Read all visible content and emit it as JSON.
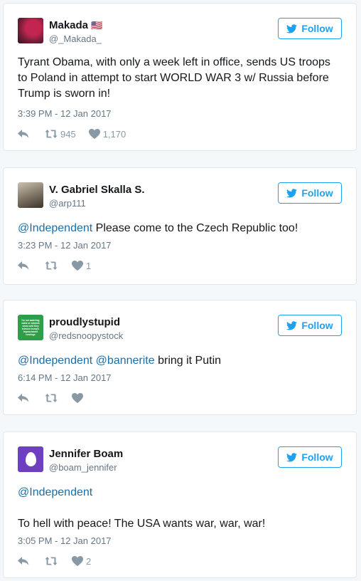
{
  "tweets": [
    {
      "name": "Makada",
      "flag": "🇺🇸",
      "handle": "@_Makada_",
      "follow_label": "Follow",
      "text_plain": "Tyrant Obama, with only a week left in office, sends US troops to Poland in attempt to start WORLD WAR 3 w/ Russia before Trump is sworn in!",
      "time": "3:39 PM - 12 Jan 2017",
      "retweets": "945",
      "likes": "1,170"
    },
    {
      "name": "V. Gabriel Skalla S.",
      "handle": "@arp111",
      "follow_label": "Follow",
      "mention1": "@Independent",
      "text_rest": " Please come to the Czech Republic too!",
      "time": "3:23 PM - 12 Jan 2017",
      "retweets": "",
      "likes": "1"
    },
    {
      "name": "proudlystupid",
      "handle": "@redsnoopystock",
      "follow_label": "Follow",
      "mention1": "@Independent",
      "mention2": "@bannerite",
      "text_rest": " bring it Putin",
      "time": "6:14 PM - 12 Jan 2017",
      "retweets": "",
      "likes": "",
      "avatar_text": "I'm not watching cable or network news until they televise trump's impeachment hearings"
    },
    {
      "name": "Jennifer Boam",
      "handle": "@boam_jennifer",
      "follow_label": "Follow",
      "mention1": "@Independent",
      "text_rest": "To hell with peace! The USA wants war, war, war!",
      "time": "3:05 PM - 12 Jan 2017",
      "retweets": "",
      "likes": "2"
    }
  ],
  "colors": {
    "accent": "#1da1f2",
    "mention": "#1b6ea8",
    "muted": "#657786",
    "egg_purple": "#6e3fbf",
    "avatar_green": "#2e9e48"
  }
}
